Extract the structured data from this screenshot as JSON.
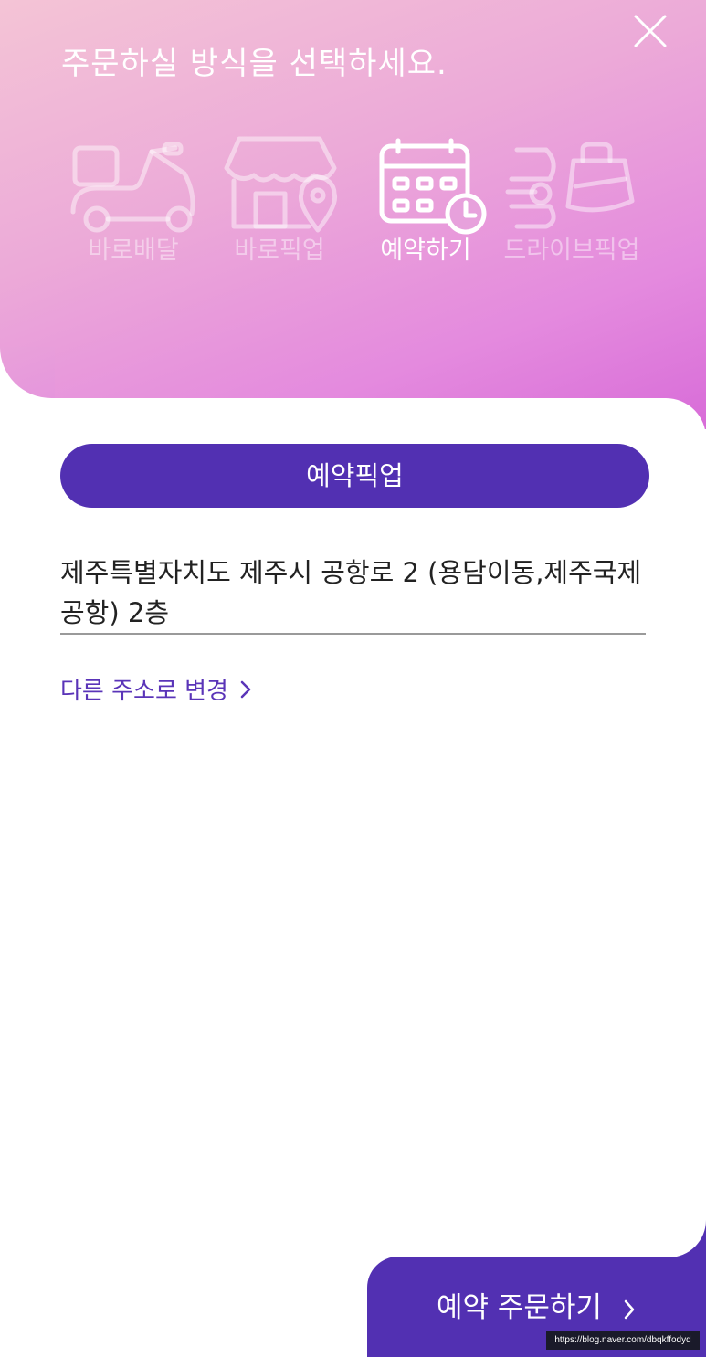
{
  "header": {
    "title": "주문하실 방식을 선택하세요."
  },
  "order_types": [
    {
      "label": "바로배달",
      "icon": "scooter-icon",
      "active": false
    },
    {
      "label": "바로픽업",
      "icon": "store-pin-icon",
      "active": false
    },
    {
      "label": "예약하기",
      "icon": "calendar-clock-icon",
      "active": true
    },
    {
      "label": "드라이브픽업",
      "icon": "car-bag-icon",
      "active": false
    }
  ],
  "pickup": {
    "mode_label": "예약픽업",
    "address": "제주특별자치도 제주시 공항로 2 (용담이동,제주국제공항) 2층",
    "change_label": "다른 주소로 변경"
  },
  "footer": {
    "order_label": "예약 주문하기"
  },
  "watermark": "https://blog.naver.com/dbqkffodyd",
  "colors": {
    "accent": "#5230b2",
    "link": "#5a34b8",
    "header_gradient_start": "#f4c4d6",
    "header_gradient_end": "#d86cd8"
  }
}
